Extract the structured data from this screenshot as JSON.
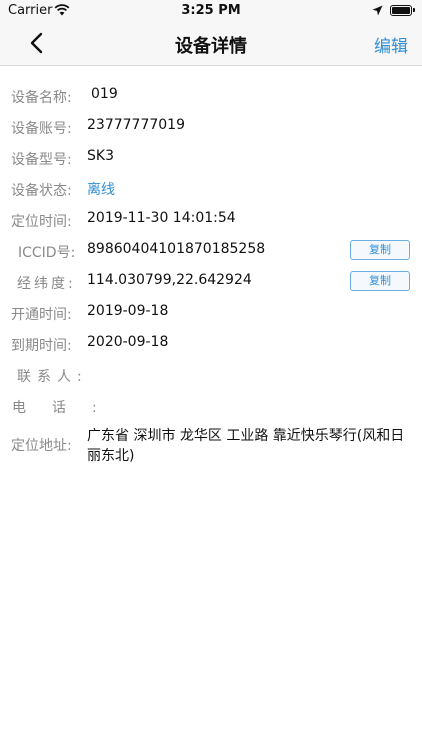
{
  "status_bar": {
    "carrier": "Carrier",
    "time": "3:25 PM",
    "wifi_icon": "wifi-icon",
    "location_icon": "location-arrow-icon",
    "battery_icon": "battery-full-icon"
  },
  "nav": {
    "back_icon": "chevron-left-icon",
    "title": "设备详情",
    "edit_label": "编辑",
    "accent_color": "#2f8fd8"
  },
  "fields": {
    "name": {
      "label": "设备名称:",
      "value": "019"
    },
    "account": {
      "label": "设备账号:",
      "value": "23777777019"
    },
    "model": {
      "label": "设备型号:",
      "value": "SK3"
    },
    "status": {
      "label": "设备状态:",
      "value": "离线",
      "color": "#2f8fd8"
    },
    "location_time": {
      "label": "定位时间:",
      "value": "2019-11-30 14:01:54"
    },
    "iccid": {
      "label": "ICCID号:",
      "value": "89860404101870185258",
      "copy_label": "复制"
    },
    "coords": {
      "label": "经纬度:",
      "value": "114.030799,22.642924",
      "copy_label": "复制"
    },
    "activated": {
      "label": "开通时间:",
      "value": "2019-09-18"
    },
    "expires": {
      "label": "到期时间:",
      "value": "2020-09-18"
    },
    "contact": {
      "label": "联系人:",
      "value": ""
    },
    "phone": {
      "label": "电话:",
      "value": ""
    },
    "address": {
      "label": "定位地址:",
      "value": "广东省 深圳市 龙华区 工业路 靠近快乐琴行(风和日丽东北)"
    }
  }
}
